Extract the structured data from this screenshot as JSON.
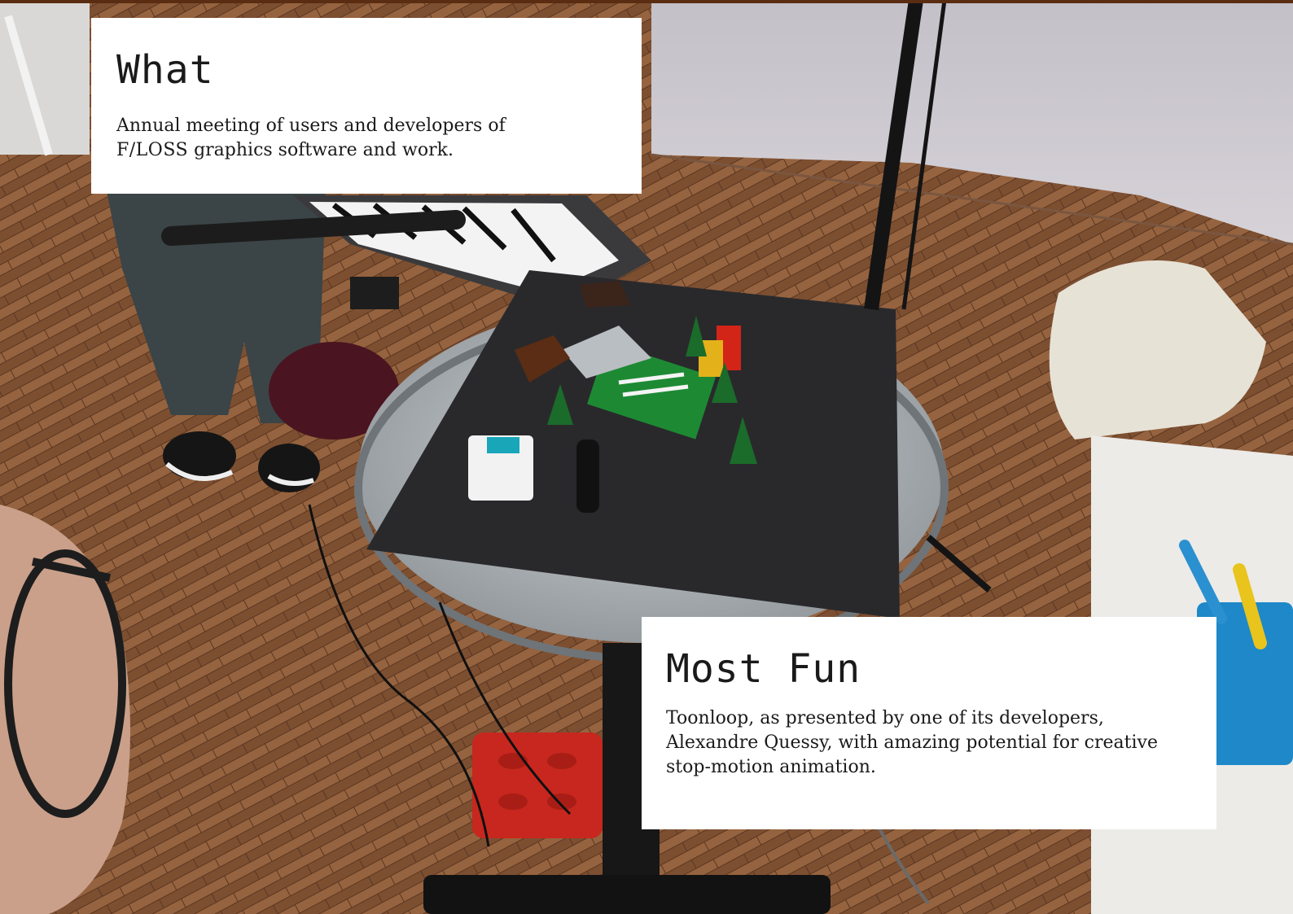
{
  "cards": {
    "what": {
      "heading": "What",
      "text_before": "Annual meeting of users and developers of ",
      "text_smallcaps": "F/LOSS",
      "text_after": " graphics software and work."
    },
    "most_fun": {
      "heading": "Most Fun",
      "text": "Toonloop, as presented by one of its developers, Alexandre Quessy, with amazing potential for creative stop-motion animation."
    }
  },
  "colors": {
    "floor": "#8a5a3a",
    "board": "#2b2b2e",
    "card_bg": "#ffffff",
    "text": "#1a1a1a"
  }
}
